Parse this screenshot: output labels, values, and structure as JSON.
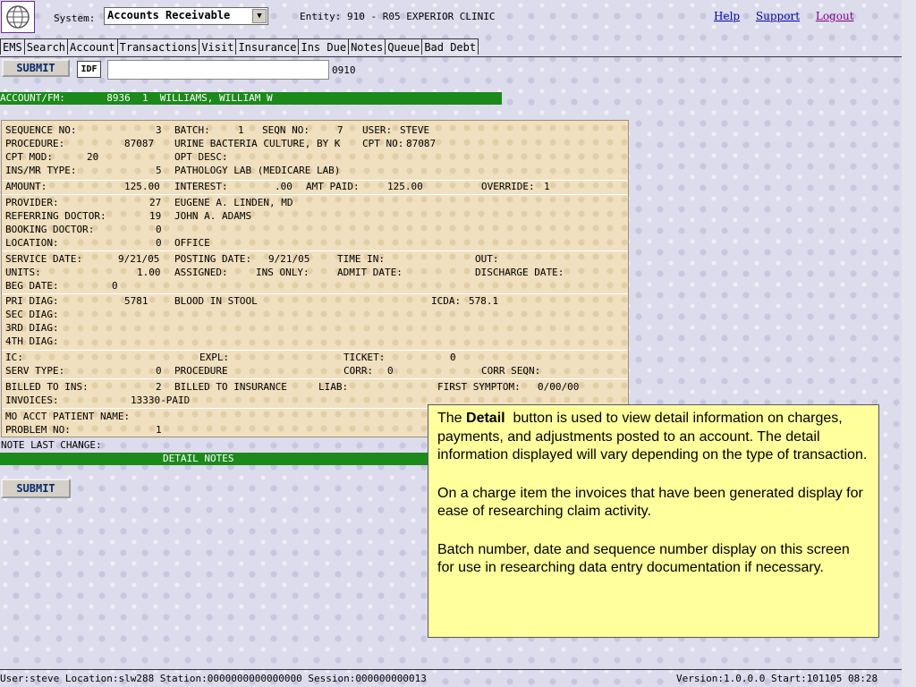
{
  "header": {
    "system_label": "System:",
    "system_value": "Accounts Receivable",
    "entity": "Entity: 910 - R05 EXPERIOR CLINIC",
    "links": [
      "Help",
      "Support",
      "Logout"
    ]
  },
  "tabs": [
    "EMS",
    "Search",
    "Account",
    "Transactions",
    "Visit",
    "Insurance",
    "Ins Due",
    "Notes",
    "Queue",
    "Bad Debt"
  ],
  "command": {
    "submit_label": "SUBMIT",
    "idf": "IDF",
    "input_value": "",
    "code": "0910"
  },
  "account_bar": "ACCOUNT/FM:       8936  1  WILLIAMS, WILLIAM W",
  "detail": {
    "sequence_no": {
      "label": "SEQUENCE NO:",
      "value": "3"
    },
    "batch": {
      "label": "BATCH:",
      "value": "1"
    },
    "seqn_no": {
      "label": "SEQN NO:",
      "value": "7"
    },
    "user": {
      "label": "USER:",
      "value": "STEVE"
    },
    "procedure": {
      "label": "PROCEDURE:",
      "code": "87087",
      "desc": "URINE BACTERIA CULTURE, BY K"
    },
    "cpt_no": {
      "label": "CPT NO:",
      "value": "87087"
    },
    "cpt_mod": {
      "label": "CPT MOD:",
      "value": "20"
    },
    "opt_desc": {
      "label": "OPT DESC:",
      "value": ""
    },
    "ins_mr_type": {
      "label": "INS/MR TYPE:",
      "code": "5",
      "desc": "PATHOLOGY LAB (MEDICARE LAB)"
    },
    "amount": {
      "label": "AMOUNT:",
      "value": "125.00"
    },
    "interest": {
      "label": "INTEREST:",
      "value": ".00"
    },
    "amt_paid": {
      "label": "AMT PAID:",
      "value": "125.00"
    },
    "override": {
      "label": "OVERRIDE:",
      "value": "1"
    },
    "provider": {
      "label": "PROVIDER:",
      "code": "27",
      "name": "EUGENE A. LINDEN, MD"
    },
    "referring_doctor": {
      "label": "REFERRING DOCTOR:",
      "code": "19",
      "name": "JOHN A. ADAMS"
    },
    "booking_doctor": {
      "label": "BOOKING DOCTOR:",
      "code": "0"
    },
    "location": {
      "label": "LOCATION:",
      "code": "0",
      "name": "OFFICE"
    },
    "service_date": {
      "label": "SERVICE DATE:",
      "value": "9/21/05"
    },
    "posting_date": {
      "label": "POSTING DATE:",
      "value": "9/21/05"
    },
    "time_in": {
      "label": "TIME IN:",
      "value": ""
    },
    "out": {
      "label": "OUT:",
      "value": ""
    },
    "units": {
      "label": "UNITS:",
      "value": "1.00"
    },
    "assigned": {
      "label": "ASSIGNED:",
      "value": "INS ONLY:"
    },
    "admit_date": {
      "label": "ADMIT DATE:",
      "value": ""
    },
    "discharge_date": {
      "label": "DISCHARGE DATE:",
      "value": ""
    },
    "beg_date": {
      "label": "BEG DATE:",
      "value": "0"
    },
    "pri_diag": {
      "label": "PRI DIAG:",
      "code": "5781",
      "desc": "BLOOD IN STOOL"
    },
    "icda": {
      "label": "ICDA:",
      "value": "578.1"
    },
    "sec_diag": {
      "label": "SEC DIAG:"
    },
    "third_diag": {
      "label": "3RD DIAG:"
    },
    "fourth_diag": {
      "label": "4TH DIAG:"
    },
    "ic": {
      "label": "IC:"
    },
    "expl": {
      "label": "EXPL:"
    },
    "ticket": {
      "label": "TICKET:",
      "value": "0"
    },
    "serv_type": {
      "label": "SERV TYPE:",
      "code": "0",
      "desc": "PROCEDURE"
    },
    "corr": {
      "label": "CORR:",
      "value": "0"
    },
    "corr_seqn": {
      "label": "CORR SEQN:"
    },
    "billed_to_ins": {
      "label": "BILLED TO INS:",
      "code": "2",
      "desc": "BILLED TO INSURANCE"
    },
    "liab": {
      "label": "LIAB:"
    },
    "first_symptom": {
      "label": "FIRST SYMPTOM:",
      "value": "0/00/00"
    },
    "invoices": {
      "label": "INVOICES:",
      "value": "13330-PAID"
    },
    "mo_acct_patient_name": {
      "label": "MO ACCT PATIENT NAME:"
    },
    "problem_no": {
      "label": "PROBLEM NO:",
      "value": "1"
    }
  },
  "note_last_change": "NOTE LAST CHANGE:",
  "detail_notes_bar": "DETAIL NOTES",
  "submit2_label": "SUBMIT",
  "callout": {
    "p1_pre": "The ",
    "p1_bold": "Detail",
    "p1_post": "  button is used to view detail information on charges, payments, and adjustments posted to an account. The detail information displayed will vary depending on the type of transaction.",
    "p2": "On a charge item the invoices that have been generated display for ease of researching claim activity.",
    "p3": "Batch number, date and sequence number display on this screen for use in researching data entry documentation if necessary."
  },
  "status": {
    "left": "User:steve Location:slw288 Station:0000000000000000 Session:000000000013",
    "right": "Version:1.0.0.0  Start:101105 08:28"
  }
}
